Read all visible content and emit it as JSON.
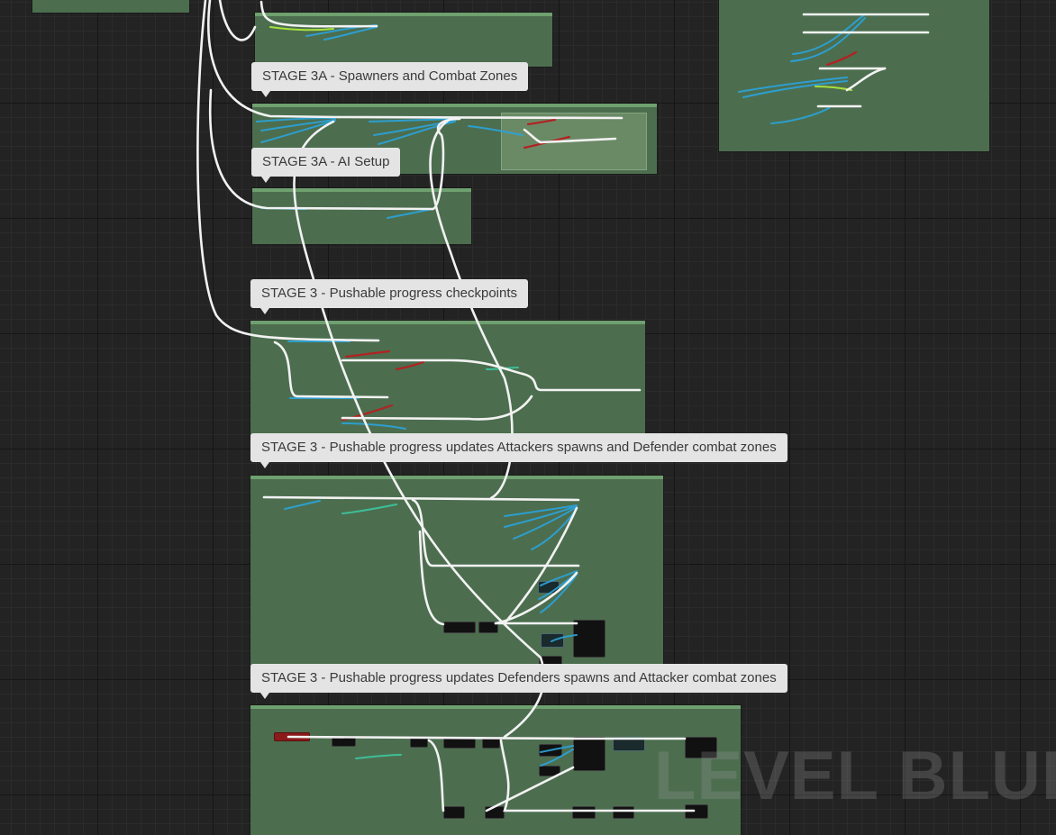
{
  "comments": {
    "stage3a_spawners": "STAGE 3A - Spawners and Combat Zones",
    "stage3a_ai_setup": "STAGE 3A - AI Setup",
    "stage3_checkpoints": "STAGE 3 - Pushable progress checkpoints",
    "stage3_attackers": "STAGE 3 - Pushable progress updates Attackers spawns and Defender combat zones",
    "stage3_defenders": "STAGE 3 - Pushable progress updates Defenders spawns and Attacker combat zones"
  },
  "watermark": "LEVEL BLUEP",
  "colors": {
    "canvas": "#232323",
    "comment_bg": "#4c6e4f",
    "exec_wire": "#ffffff",
    "object_wire": "#2aa4dc",
    "bool_wire": "#b22222",
    "struct_wire": "#3cc8a0",
    "float_wire": "#a8e03c"
  }
}
